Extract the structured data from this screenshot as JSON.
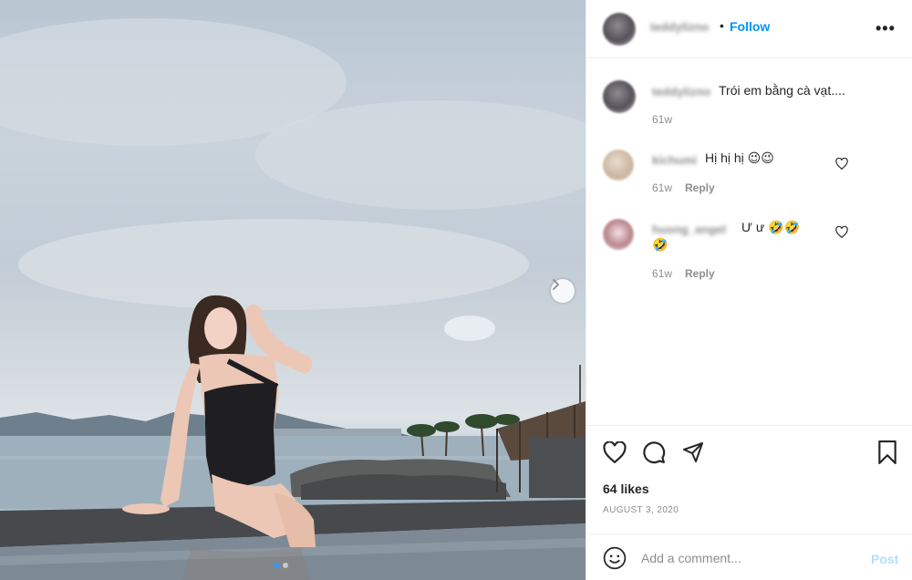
{
  "post": {
    "image_alt": "Woman in black swimsuit sitting at the edge of an infinity pool by the sea",
    "carousel_dots": 2,
    "active_dot": 0
  },
  "header": {
    "username": "teddylizno",
    "separator": "•",
    "follow_label": "Follow",
    "more_label": "•••"
  },
  "comments": [
    {
      "username": "teddylizno",
      "text": "Trói em bằng cà vạt....",
      "time": "61w",
      "reply": ""
    },
    {
      "username": "kichumi",
      "text": "Hị hị hị 😉😉",
      "time": "61w",
      "reply": "Reply"
    },
    {
      "username": "huong_angel",
      "text": "Ư ư 🤣🤣",
      "text2": "🤣",
      "time": "61w",
      "reply": "Reply"
    }
  ],
  "actions": {
    "likes": "64 likes",
    "date": "AUGUST 3, 2020",
    "icons": [
      "heart-icon",
      "comment-icon",
      "share-icon",
      "bookmark-icon"
    ]
  },
  "add_comment": {
    "placeholder": "Add a comment...",
    "post_label": "Post"
  },
  "colors": {
    "accent": "#0095f6",
    "post_disabled": "#b2dffc",
    "muted": "#8e8e8e"
  }
}
